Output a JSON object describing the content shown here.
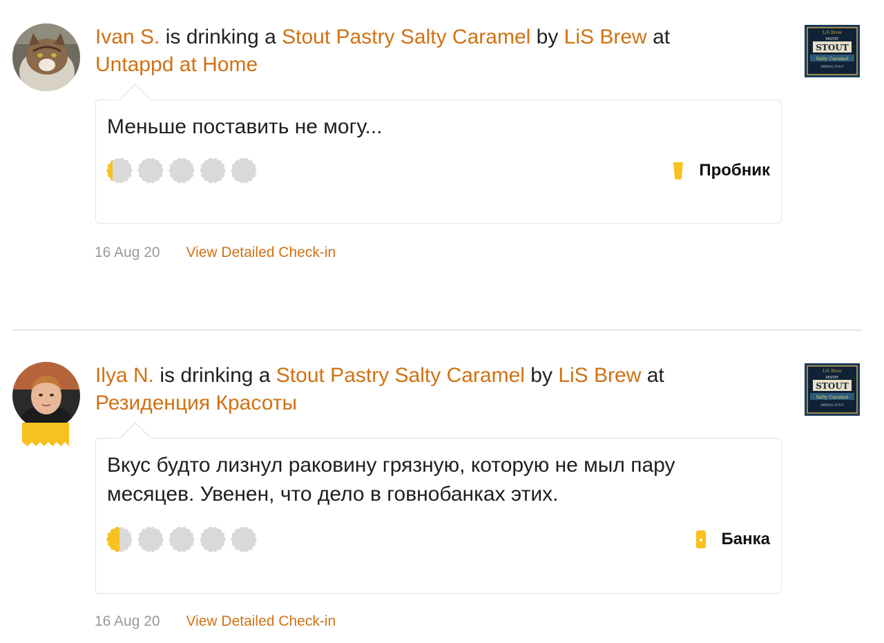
{
  "colors": {
    "link": "#d07112",
    "cap_filled": "#f7c11f",
    "cap_empty": "#d9d9d9",
    "divider": "#e6e6e6"
  },
  "checkins": [
    {
      "user": "Ivan S.",
      "drinking_text": "is drinking a",
      "beer": "Stout Pastry Salty Caramel",
      "by_text": "by",
      "brewery": "LiS Brew",
      "at_text": "at",
      "venue": "Untappd at Home",
      "comment": "Меньше поставить не могу...",
      "rating": 0.25,
      "rating_max": 5,
      "serving": "Пробник",
      "serving_icon": "taster-glass-icon",
      "date": "16 Aug 20",
      "detail_link": "View Detailed Check-in",
      "beer_label_text": {
        "brand": "LiS Brew",
        "style": "PASTRY",
        "name": "STOUT",
        "flavor": "Salty Caramel",
        "bottom": "IMPERIAL STOUT"
      }
    },
    {
      "user": "Ilya N.",
      "drinking_text": "is drinking a",
      "beer": "Stout Pastry Salty Caramel",
      "by_text": "by",
      "brewery": "LiS Brew",
      "at_text": "at",
      "venue": "Резиденция Красоты",
      "comment": "Вкус будто лизнул раковину грязную, которую не мыл пару месяцев. Увенен, что дело в говнобанках этих.",
      "rating": 0.5,
      "rating_max": 5,
      "serving": "Банка",
      "serving_icon": "can-icon",
      "date": "16 Aug 20",
      "detail_link": "View Detailed Check-in",
      "beer_label_text": {
        "brand": "LiS Brew",
        "style": "PASTRY",
        "name": "STOUT",
        "flavor": "Salty Caramel",
        "bottom": "IMPERIAL STOUT"
      }
    }
  ]
}
